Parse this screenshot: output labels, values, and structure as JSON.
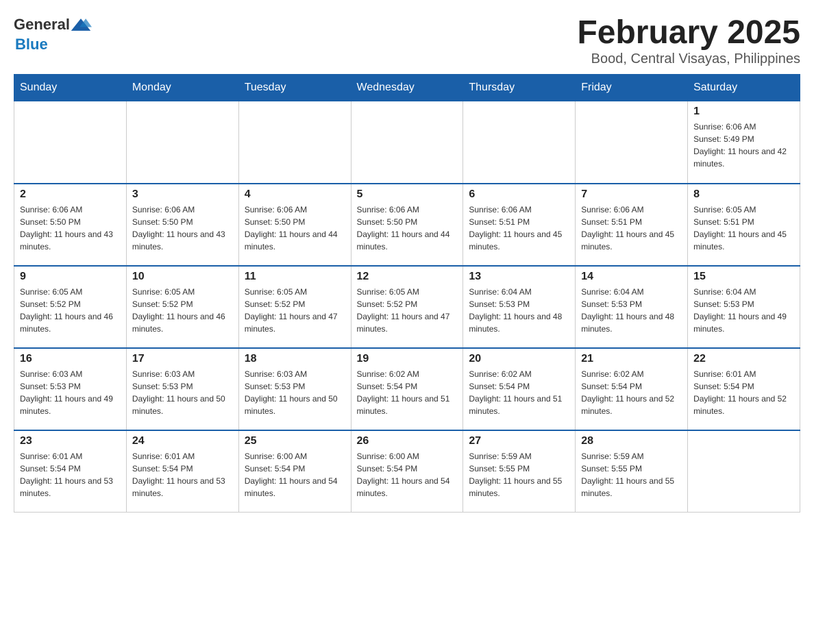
{
  "logo": {
    "general": "General",
    "blue": "Blue"
  },
  "title": "February 2025",
  "subtitle": "Bood, Central Visayas, Philippines",
  "days_of_week": [
    "Sunday",
    "Monday",
    "Tuesday",
    "Wednesday",
    "Thursday",
    "Friday",
    "Saturday"
  ],
  "weeks": [
    [
      {
        "day": "",
        "info": ""
      },
      {
        "day": "",
        "info": ""
      },
      {
        "day": "",
        "info": ""
      },
      {
        "day": "",
        "info": ""
      },
      {
        "day": "",
        "info": ""
      },
      {
        "day": "",
        "info": ""
      },
      {
        "day": "1",
        "info": "Sunrise: 6:06 AM\nSunset: 5:49 PM\nDaylight: 11 hours and 42 minutes."
      }
    ],
    [
      {
        "day": "2",
        "info": "Sunrise: 6:06 AM\nSunset: 5:50 PM\nDaylight: 11 hours and 43 minutes."
      },
      {
        "day": "3",
        "info": "Sunrise: 6:06 AM\nSunset: 5:50 PM\nDaylight: 11 hours and 43 minutes."
      },
      {
        "day": "4",
        "info": "Sunrise: 6:06 AM\nSunset: 5:50 PM\nDaylight: 11 hours and 44 minutes."
      },
      {
        "day": "5",
        "info": "Sunrise: 6:06 AM\nSunset: 5:50 PM\nDaylight: 11 hours and 44 minutes."
      },
      {
        "day": "6",
        "info": "Sunrise: 6:06 AM\nSunset: 5:51 PM\nDaylight: 11 hours and 45 minutes."
      },
      {
        "day": "7",
        "info": "Sunrise: 6:06 AM\nSunset: 5:51 PM\nDaylight: 11 hours and 45 minutes."
      },
      {
        "day": "8",
        "info": "Sunrise: 6:05 AM\nSunset: 5:51 PM\nDaylight: 11 hours and 45 minutes."
      }
    ],
    [
      {
        "day": "9",
        "info": "Sunrise: 6:05 AM\nSunset: 5:52 PM\nDaylight: 11 hours and 46 minutes."
      },
      {
        "day": "10",
        "info": "Sunrise: 6:05 AM\nSunset: 5:52 PM\nDaylight: 11 hours and 46 minutes."
      },
      {
        "day": "11",
        "info": "Sunrise: 6:05 AM\nSunset: 5:52 PM\nDaylight: 11 hours and 47 minutes."
      },
      {
        "day": "12",
        "info": "Sunrise: 6:05 AM\nSunset: 5:52 PM\nDaylight: 11 hours and 47 minutes."
      },
      {
        "day": "13",
        "info": "Sunrise: 6:04 AM\nSunset: 5:53 PM\nDaylight: 11 hours and 48 minutes."
      },
      {
        "day": "14",
        "info": "Sunrise: 6:04 AM\nSunset: 5:53 PM\nDaylight: 11 hours and 48 minutes."
      },
      {
        "day": "15",
        "info": "Sunrise: 6:04 AM\nSunset: 5:53 PM\nDaylight: 11 hours and 49 minutes."
      }
    ],
    [
      {
        "day": "16",
        "info": "Sunrise: 6:03 AM\nSunset: 5:53 PM\nDaylight: 11 hours and 49 minutes."
      },
      {
        "day": "17",
        "info": "Sunrise: 6:03 AM\nSunset: 5:53 PM\nDaylight: 11 hours and 50 minutes."
      },
      {
        "day": "18",
        "info": "Sunrise: 6:03 AM\nSunset: 5:53 PM\nDaylight: 11 hours and 50 minutes."
      },
      {
        "day": "19",
        "info": "Sunrise: 6:02 AM\nSunset: 5:54 PM\nDaylight: 11 hours and 51 minutes."
      },
      {
        "day": "20",
        "info": "Sunrise: 6:02 AM\nSunset: 5:54 PM\nDaylight: 11 hours and 51 minutes."
      },
      {
        "day": "21",
        "info": "Sunrise: 6:02 AM\nSunset: 5:54 PM\nDaylight: 11 hours and 52 minutes."
      },
      {
        "day": "22",
        "info": "Sunrise: 6:01 AM\nSunset: 5:54 PM\nDaylight: 11 hours and 52 minutes."
      }
    ],
    [
      {
        "day": "23",
        "info": "Sunrise: 6:01 AM\nSunset: 5:54 PM\nDaylight: 11 hours and 53 minutes."
      },
      {
        "day": "24",
        "info": "Sunrise: 6:01 AM\nSunset: 5:54 PM\nDaylight: 11 hours and 53 minutes."
      },
      {
        "day": "25",
        "info": "Sunrise: 6:00 AM\nSunset: 5:54 PM\nDaylight: 11 hours and 54 minutes."
      },
      {
        "day": "26",
        "info": "Sunrise: 6:00 AM\nSunset: 5:54 PM\nDaylight: 11 hours and 54 minutes."
      },
      {
        "day": "27",
        "info": "Sunrise: 5:59 AM\nSunset: 5:55 PM\nDaylight: 11 hours and 55 minutes."
      },
      {
        "day": "28",
        "info": "Sunrise: 5:59 AM\nSunset: 5:55 PM\nDaylight: 11 hours and 55 minutes."
      },
      {
        "day": "",
        "info": ""
      }
    ]
  ]
}
